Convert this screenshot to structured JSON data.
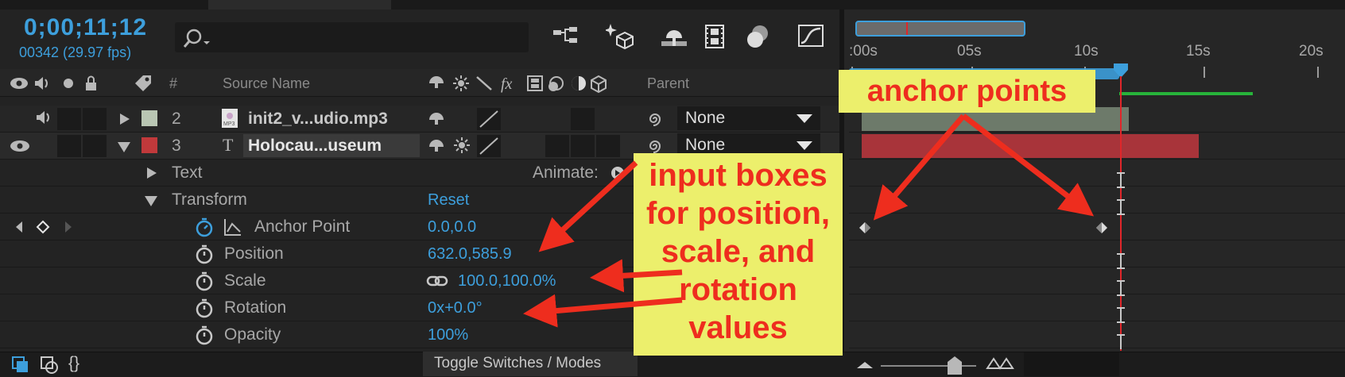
{
  "composition": {
    "timecode": "0;00;11;12",
    "frame_info": "00342 (29.97 fps)"
  },
  "search": {
    "placeholder": ""
  },
  "toolbar_icons": [
    "flowchart-icon",
    "draft-3d-icon",
    "motion-blur-icon",
    "frame-blending-icon",
    "shy-layers-icon",
    "graph-editor-icon"
  ],
  "layer_header": {
    "number_label": "#",
    "source_name_label": "Source Name",
    "parent_label": "Parent"
  },
  "layers": [
    {
      "number": "2",
      "name": "init2_v...udio.mp3",
      "parent": "None",
      "label_color": "#b9c6b3"
    },
    {
      "number": "3",
      "name": "Holocau...useum",
      "parent": "None",
      "label_color": "#c1393b"
    }
  ],
  "properties": {
    "text_label": "Text",
    "animate_label": "Animate:",
    "transform_label": "Transform",
    "reset_label": "Reset",
    "anchor_point": {
      "label": "Anchor Point",
      "value": "0.0,0.0"
    },
    "position": {
      "label": "Position",
      "value": "632.0,585.9"
    },
    "scale": {
      "label": "Scale",
      "value": "100.0,100.0%"
    },
    "rotation": {
      "label": "Rotation",
      "value": "0x+0.0°"
    },
    "opacity": {
      "label": "Opacity",
      "value": "100%"
    }
  },
  "timeline": {
    "ticks": [
      ":00s",
      "05s",
      "10s",
      "15s",
      "20s"
    ],
    "current_time_seconds": 11.4
  },
  "footer": {
    "toggle_label": "Toggle Switches / Modes"
  },
  "annotations": {
    "anchor_points": "anchor points",
    "input_boxes": [
      "input boxes",
      "for position,",
      "scale, and",
      "rotation",
      "values"
    ]
  },
  "colors": {
    "accent_blue": "#3d9fdc",
    "callout_bg": "#ecef6c",
    "callout_text": "#ee2d1e",
    "arrow_red": "#ee2d1e",
    "playhead_red": "#e0262a"
  }
}
